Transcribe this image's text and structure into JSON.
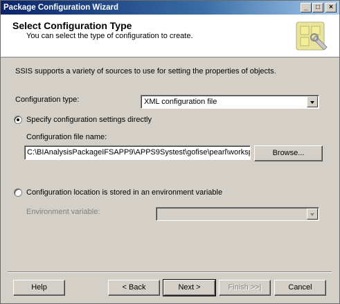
{
  "window": {
    "title": "Package Configuration Wizard"
  },
  "header": {
    "title": "Select Configuration Type",
    "subtitle": "You can select the type of configuration to create."
  },
  "intro_text": "SSIS supports a variety of sources to use for setting the properties of objects.",
  "configuration_type": {
    "label": "Configuration type:",
    "value": "XML configuration file"
  },
  "option_direct": {
    "label": "Specify configuration settings directly",
    "selected": true,
    "file_name_label": "Configuration file name:",
    "file_name_value": "C:\\BIAnalysisPackageIFSAPP9\\APPS9Systest\\gofise\\pearl\\worksp",
    "browse_label": "Browse..."
  },
  "option_env": {
    "label": "Configuration location is stored in an environment variable",
    "selected": false,
    "env_var_label": "Environment variable:",
    "env_var_value": ""
  },
  "buttons": {
    "help": "Help",
    "back": "< Back",
    "next": "Next >",
    "finish": "Finish >>|",
    "cancel": "Cancel"
  },
  "icons": {
    "header_logo": "wizard-config-icon",
    "minimize": "minimize-icon",
    "maximize": "maximize-icon",
    "close": "close-icon"
  },
  "colors": {
    "titlebar": "#0a246a",
    "face": "#d4d0c8",
    "disabled_text": "#808080"
  }
}
